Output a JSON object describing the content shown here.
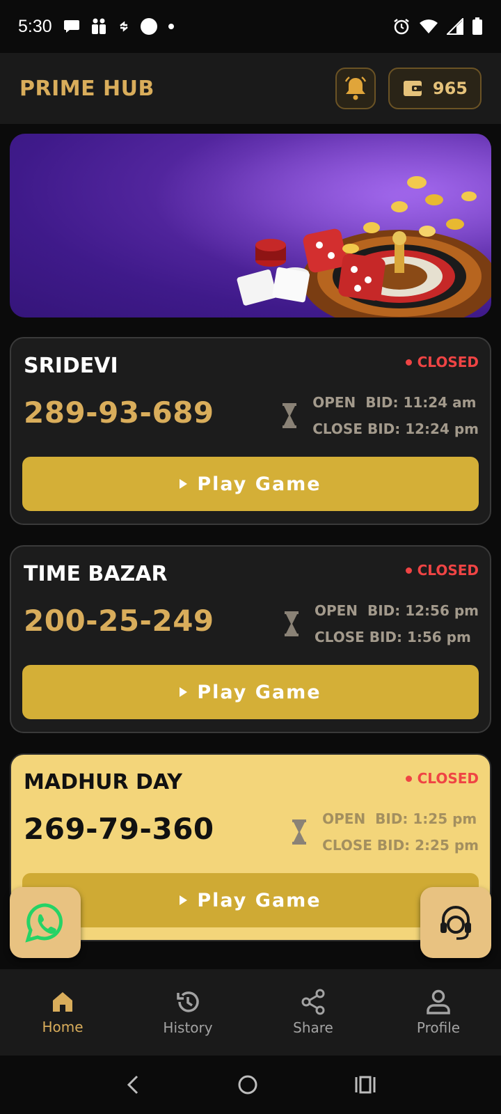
{
  "status_bar": {
    "time": "5:30"
  },
  "header": {
    "title": "PRIME HUB",
    "wallet_balance": "965"
  },
  "colors": {
    "accent": "#d9ad5b",
    "button": "#d4af37",
    "closed": "#ef4444",
    "highlight_card": "#f3d57a"
  },
  "games": [
    {
      "name": "SRIDEVI",
      "status": "CLOSED",
      "result": "289-93-689",
      "open_bid": "OPEN  BID: 11:24 am",
      "close_bid": "CLOSE BID: 12:24 pm",
      "play_label": "Play Game"
    },
    {
      "name": "TIME BAZAR",
      "status": "CLOSED",
      "result": "200-25-249",
      "open_bid": "OPEN  BID: 12:56 pm",
      "close_bid": "CLOSE BID: 1:56 pm",
      "play_label": "Play Game"
    },
    {
      "name": "MADHUR DAY",
      "status": "CLOSED",
      "result": "269-79-360",
      "open_bid": "OPEN  BID: 1:25 pm",
      "close_bid": "CLOSE BID: 2:25 pm",
      "play_label": "Play Game"
    }
  ],
  "bottom_nav": [
    {
      "label": "Home",
      "icon": "home-icon",
      "active": true
    },
    {
      "label": "History",
      "icon": "history-icon"
    },
    {
      "label": "Share",
      "icon": "share-icon"
    },
    {
      "label": "Profile",
      "icon": "profile-icon"
    }
  ]
}
